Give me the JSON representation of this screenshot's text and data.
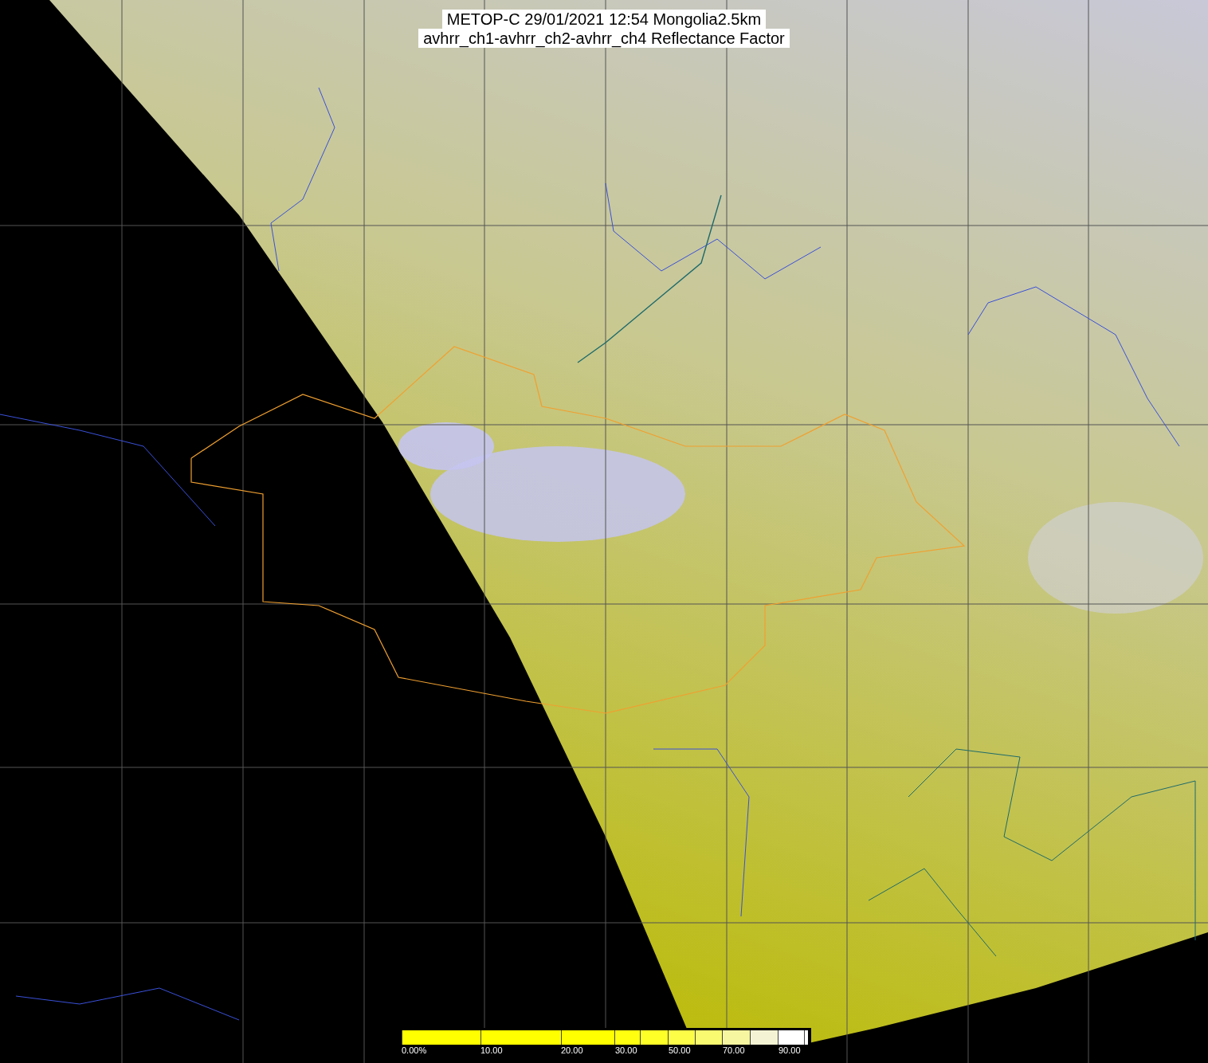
{
  "title": {
    "lines": [
      "METOP-C 29/01/2021 12:54 Mongolia2.5km",
      "avhrr_ch1-avhrr_ch2-avhrr_ch4 Reflectance Factor"
    ]
  },
  "colorbar": {
    "segments": [
      {
        "color": "#ffff00",
        "label": "0.00%"
      },
      {
        "color": "#ffff00",
        "label": "10.00"
      },
      {
        "color": "#ffff00",
        "label": "20.00"
      },
      {
        "color": "#ffff10",
        "label": "30.00"
      },
      {
        "color": "#ffff28"
      },
      {
        "color": "#fdfd48",
        "label": "50.00"
      },
      {
        "color": "#fafa70"
      },
      {
        "color": "#f6f6a0",
        "label": "70.00"
      },
      {
        "color": "#f4f4d4"
      },
      {
        "color": "#ffffff",
        "label": "90.00"
      },
      {
        "color": "#ffffff"
      }
    ]
  }
}
